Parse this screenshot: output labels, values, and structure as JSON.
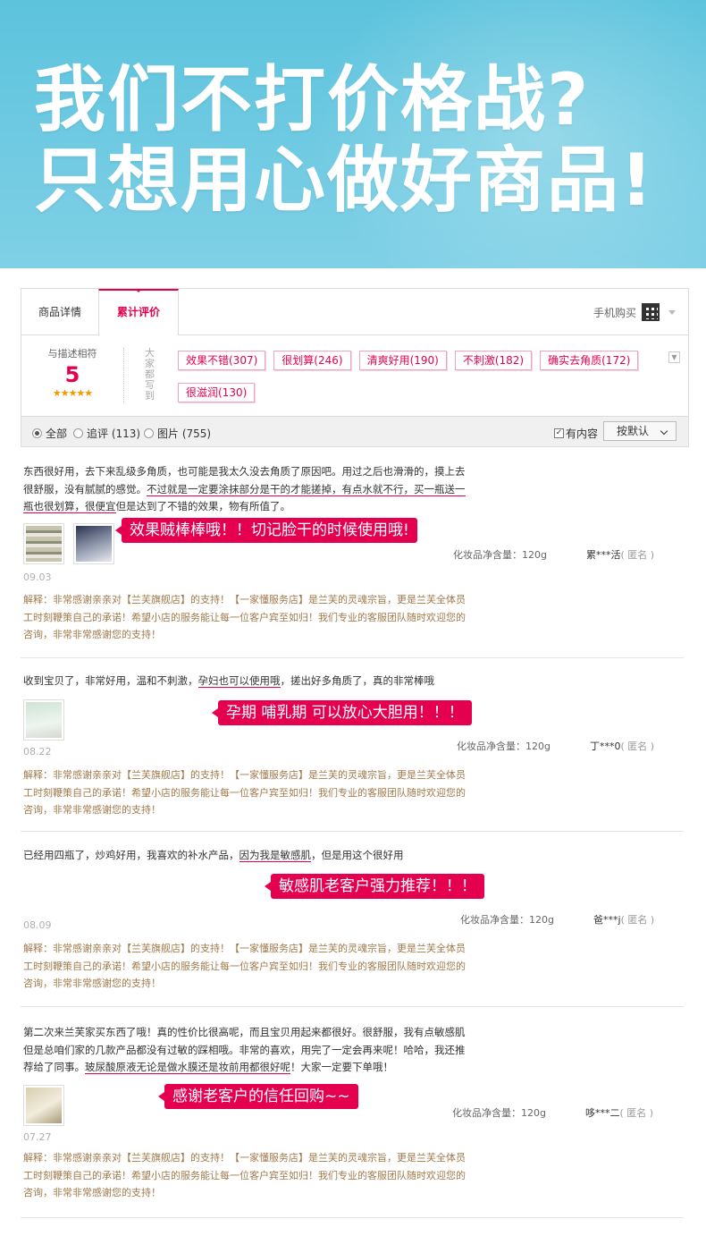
{
  "hero": {
    "line1": "我们不打价格战?",
    "line2": "只想用心做好商品!"
  },
  "tabs": {
    "details": "商品详情",
    "reviews": "累计评价",
    "mobile_buy": "手机购买"
  },
  "summary": {
    "match_label": "与描述相符",
    "score": "5",
    "stars": "★★★★★",
    "vertical_label": "大家都写到",
    "tags": [
      "效果不错(307)",
      "很划算(246)",
      "清爽好用(190)",
      "不刺激(182)",
      "确实去角质(172)",
      "很滋润(130)"
    ]
  },
  "filter": {
    "all": "全部",
    "followup": "追评 (113)",
    "pictures": "图片 (755)",
    "has_content": "有内容",
    "sort": "按默认"
  },
  "reviews": [
    {
      "text_a": "东西很好用，去下来乱级多角质，也可能是我太久没去角质了原因吧。用过之后也滑滑的，摸上去很舒服，没有腻腻的感觉。",
      "text_u": "不过就是一定要涂抹部分是干的才能搓掉，有点水就不行，买一瓶送一瓶也很划算，很便宜",
      "text_b": "但是达到了不错的效果，物有所值了。",
      "callout": "效果贼棒棒哦！！切记脸干的时候使用哦!",
      "date": "09.03",
      "spec": "化妆品净含量：120g",
      "user": "累***活",
      "anon": "( 匿名 )",
      "reply": "解释：非常感谢亲亲对【兰芙旗舰店】的支持！【一家懂服务店】是兰芙的灵魂宗旨，更是兰芙全体员工时刻鞭策自己的承诺！希望小店的服务能让每一位客户宾至如归！我们专业的客服团队随时欢迎您的咨询，非常非常感谢您的支持！"
    },
    {
      "text_a": "收到宝贝了，非常好用，温和不刺激，",
      "text_u": "孕妇也可以使用哦",
      "text_b": "，搓出好多角质了，真的非常棒哦",
      "callout": "孕期 哺乳期 可以放心大胆用！！！",
      "date": "08.22",
      "spec": "化妆品净含量：120g",
      "user": "丁***0",
      "anon": "( 匿名 )",
      "reply": "解释：非常感谢亲亲对【兰芙旗舰店】的支持！【一家懂服务店】是兰芙的灵魂宗旨，更是兰芙全体员工时刻鞭策自己的承诺！希望小店的服务能让每一位客户宾至如归！我们专业的客服团队随时欢迎您的咨询，非常非常感谢您的支持！"
    },
    {
      "text_a": "已经用四瓶了，炒鸡好用，我喜欢的补水产品，",
      "text_u": "因为我是敏感肌",
      "text_b": "，但是用这个很好用",
      "callout": "敏感肌老客户强力推荐！！！",
      "date": "08.09",
      "spec": "化妆品净含量：120g",
      "user": "爸***j",
      "anon": "( 匿名 )",
      "reply": "解释：非常感谢亲亲对【兰芙旗舰店】的支持！【一家懂服务店】是兰芙的灵魂宗旨，更是兰芙全体员工时刻鞭策自己的承诺！希望小店的服务能让每一位客户宾至如归！我们专业的客服团队随时欢迎您的咨询，非常非常感谢您的支持！"
    },
    {
      "text_a": "第二次来兰芙家买东西了哦！真的性价比很高呢，而且宝贝用起来都很好。很舒服，我有点敏感肌但是总咱们家的几款产品都没有过敏的踩相哦。非常的喜欢，用完了一定会再来呢！哈哈，我还推荐给了同事。",
      "text_u": "玻尿酸原液无论是做水膜还是妆前用都很好呢",
      "text_b": "！大家一定要下单哦！",
      "callout": "感谢老客户的信任回购~~",
      "date": "07.27",
      "spec": "化妆品净含量：120g",
      "user": "哆***二",
      "anon": "( 匿名 )",
      "reply": "解释：非常感谢亲亲对【兰芙旗舰店】的支持！【一家懂服务店】是兰芙的灵魂宗旨，更是兰芙全体员工时刻鞭策自己的承诺！希望小店的服务能让每一位客户宾至如归！我们专业的客服团队随时欢迎您的咨询，非常非常感谢您的支持！"
    }
  ],
  "colors": {
    "accent": "#e5004f",
    "hero": "#5cc3dd",
    "reply": "#a07a4a"
  }
}
